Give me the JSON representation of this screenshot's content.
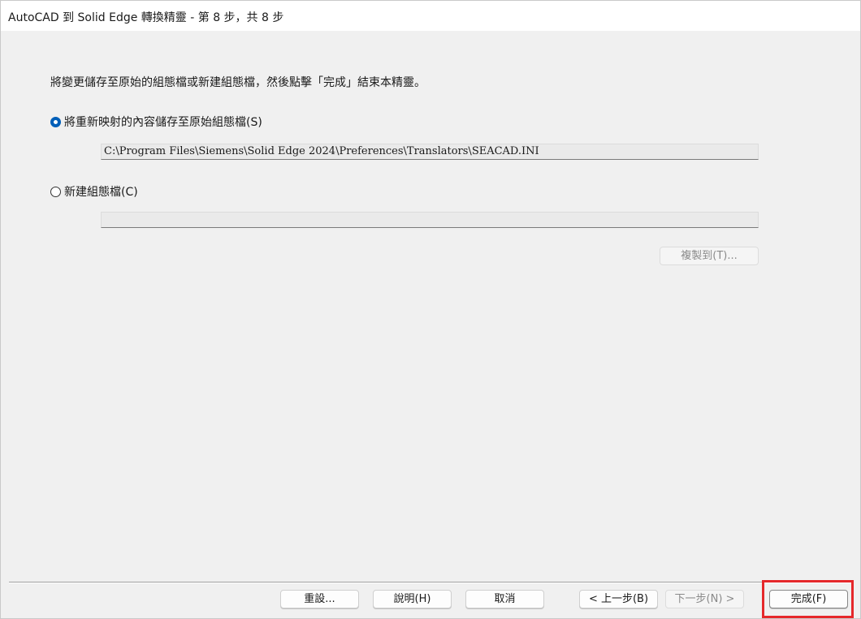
{
  "window": {
    "title": "AutoCAD 到 Solid Edge 轉換精靈 - 第 8 步，共 8 步"
  },
  "content": {
    "instruction": "將變更儲存至原始的組態檔或新建組態檔，然後點擊「完成」結束本精靈。",
    "option_save_original": {
      "label": "將重新映射的內容儲存至原始組態檔(S)",
      "selected": true,
      "path_value": "C:\\Program Files\\Siemens\\Solid Edge 2024\\Preferences\\Translators\\SEACAD.INI"
    },
    "option_new_config": {
      "label": "新建組態檔(C)",
      "selected": false,
      "path_value": ""
    },
    "copy_to_label": "複製到(T)..."
  },
  "footer": {
    "reset_label": "重設...",
    "help_label": "說明(H)",
    "cancel_label": "取消",
    "back_label": "< 上一步(B)",
    "next_label": "下一步(N) >",
    "finish_label": "完成(F)"
  },
  "colors": {
    "accent": "#005fb8",
    "highlight": "#e5282b",
    "background": "#f0f0f0"
  }
}
